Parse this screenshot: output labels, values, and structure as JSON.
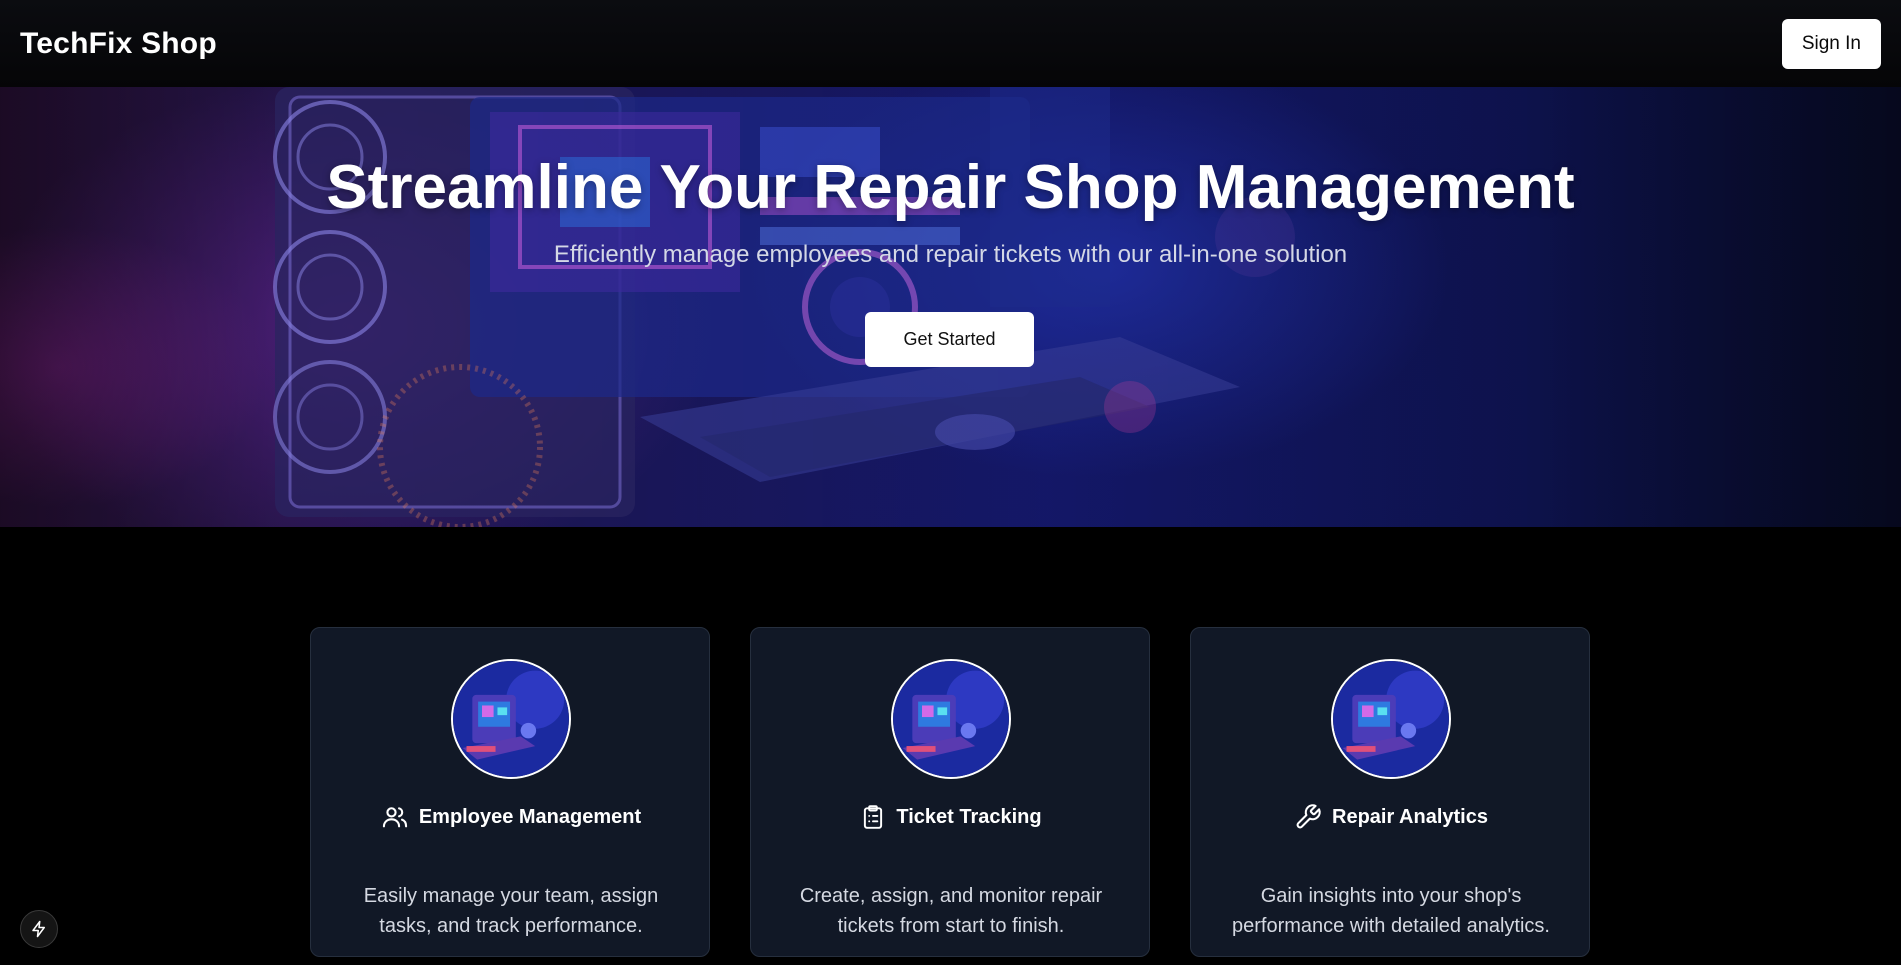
{
  "header": {
    "brand": "TechFix Shop",
    "sign_in_label": "Sign In"
  },
  "hero": {
    "title": "Streamline Your Repair Shop Management",
    "subtitle": "Efficiently manage employees and repair tickets with our all-in-one solution",
    "cta_label": "Get Started"
  },
  "features": [
    {
      "title": "Employee Management",
      "icon": "users-icon",
      "description": "Easily manage your team, assign tasks, and track performance."
    },
    {
      "title": "Ticket Tracking",
      "icon": "clipboard-list-icon",
      "description": "Create, assign, and monitor repair tickets from start to finish."
    },
    {
      "title": "Repair Analytics",
      "icon": "wrench-icon",
      "description": "Gain insights into your shop's performance with detailed analytics."
    }
  ],
  "colors": {
    "background": "#000000",
    "card_background": "#111826",
    "card_border": "#262f3e",
    "hero_accent": "#14186a"
  },
  "floating_badge_icon": "bolt-icon"
}
